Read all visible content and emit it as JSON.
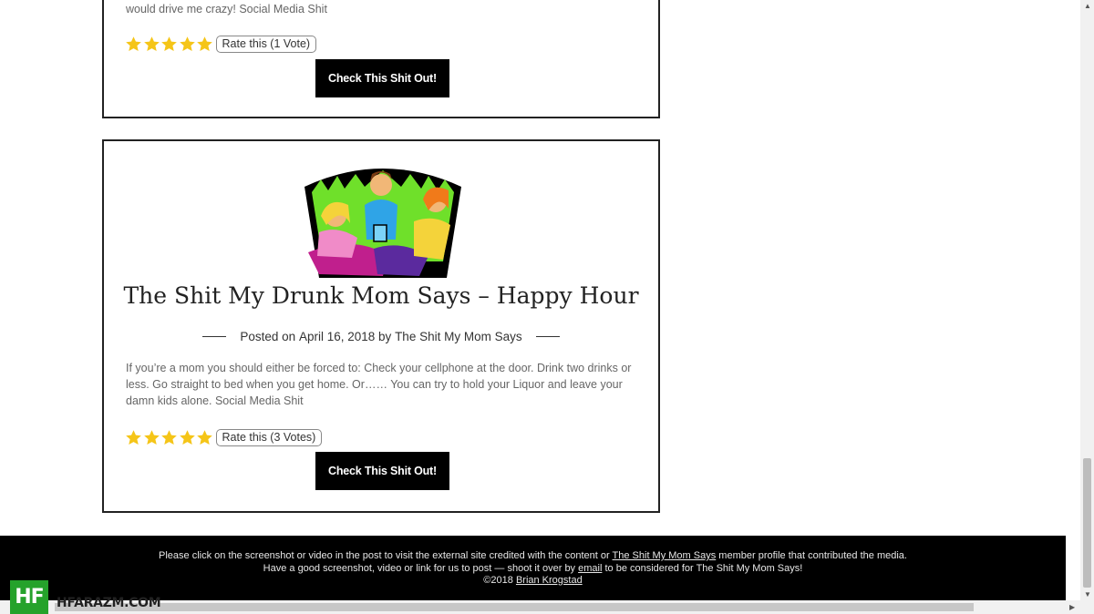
{
  "posts": [
    {
      "excerpt_tail": "would drive me crazy! Social Media Shit",
      "rating_label": "Rate this (1 Vote)",
      "cta_label": "Check This Shit Out!"
    },
    {
      "title": "The Shit My Drunk Mom Says – Happy Hour",
      "posted_prefix": "Posted on",
      "date": "April 16, 2018",
      "by_word": "by",
      "author": "The Shit My Mom Says",
      "excerpt": "If you’re a mom you should either be forced to: Check your cellphone at the door. Drink two drinks or less. Go straight to bed when you get home. Or…… You can try to hold your Liquor and leave your damn kids alone. Social Media Shit",
      "rating_label": "Rate this (3 Votes)",
      "cta_label": "Check This Shit Out!"
    }
  ],
  "rating_stars": 5,
  "footer": {
    "line1_pre": "Please click on the screenshot or video in the post to visit the external site credited with the content or",
    "line1_link": "The Shit My Mom Says",
    "line1_post": "member profile that contributed the media.",
    "line2_pre": "Have a good screenshot, video or link for us to post — shoot it over by",
    "line2_link": "email",
    "line2_post": "to be considered for The Shit My Mom Says!",
    "line3_pre": "©2018",
    "line3_link": "Brian Krogstad"
  },
  "watermark": {
    "badge": "HF",
    "text": "HFARAZM.COM",
    "color": "#25a22b"
  },
  "colors": {
    "star": "#f5c518",
    "button": "#000000",
    "footer_bg": "#000000"
  }
}
